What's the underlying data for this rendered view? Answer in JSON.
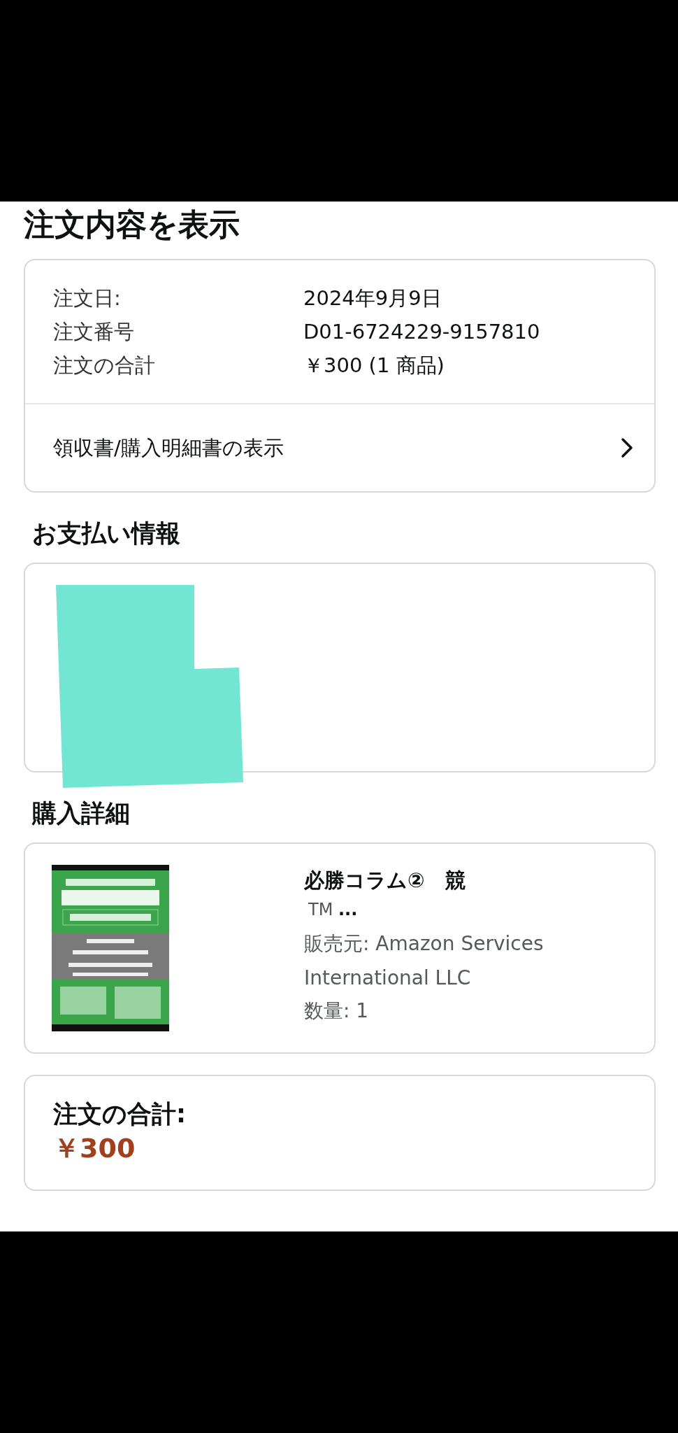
{
  "page_title": "注文内容を表示",
  "order_summary": {
    "rows": [
      {
        "label": "注文日:",
        "value": "2024年9月9日"
      },
      {
        "label": "注文番号",
        "value": "D01-6724229-9157810"
      },
      {
        "label": "注文の合計",
        "value": "￥300 (1 商品)"
      }
    ],
    "link": {
      "label": "領収書/購入明細書の表示"
    }
  },
  "payment": {
    "heading": "お支払い情報",
    "redacted": true
  },
  "details": {
    "heading": "購入詳細",
    "items": [
      {
        "title": "必勝コラム②　競",
        "title_more": "TM **...**",
        "seller": "販売元: Amazon Services International LLC",
        "quantity": "数量: 1"
      }
    ]
  },
  "total": {
    "label": "注文の合計:",
    "amount": "￥300"
  }
}
